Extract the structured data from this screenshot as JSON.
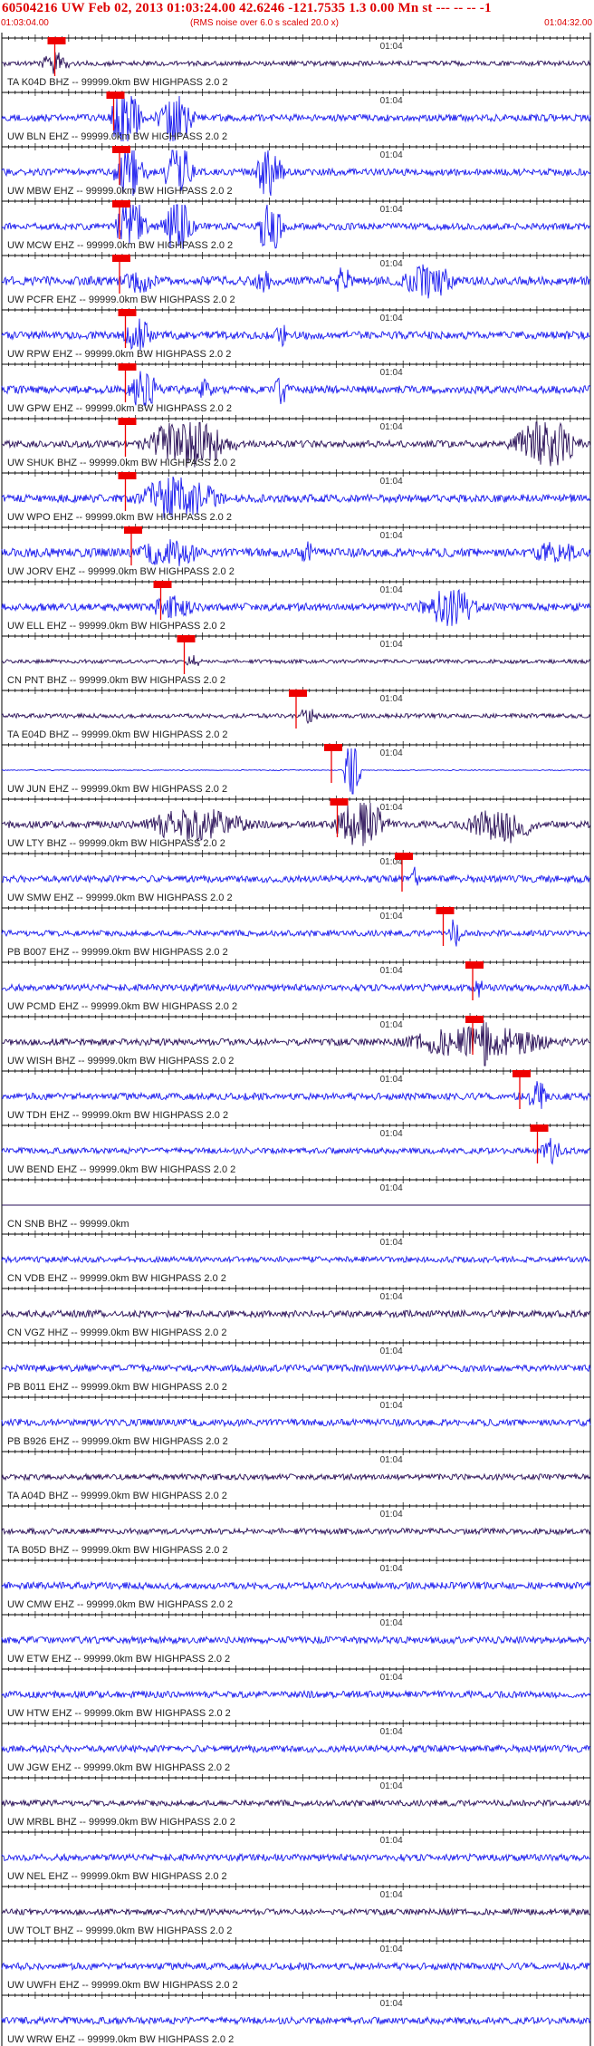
{
  "header": {
    "title": "60504216 UW Feb 02, 2013 01:03:24.00   42.6246 -121.7535  1.3 0.00 Mn st --- -- -- -1",
    "subtitle": "(RMS noise over 6.0 s scaled 20.0 x)",
    "start_time": "01:03:04.00",
    "end_time": "01:04:32.00"
  },
  "colors": {
    "header_text": "#dd0000",
    "trace_blue": "#1a1aee",
    "trace_dark": "#2a1058",
    "pick": "#ee0000",
    "axis": "#000000",
    "label": "#222222"
  },
  "chart_data": {
    "type": "line",
    "x_unit": "time",
    "x_start": "01:03:04.00",
    "x_end": "01:04:32.00",
    "minute_tick_label": "01:04",
    "series": [
      {
        "name": "TA K04D BHZ -- 99999.0km BW  HIGHPASS  2.0  2",
        "color": "dark",
        "pick": 0.09,
        "amp": 0.25,
        "bursts": [
          [
            0.06,
            0.12,
            1.2
          ]
        ]
      },
      {
        "name": "UW BLN EHZ -- 99999.0km BW  HIGHPASS  2.0  2",
        "color": "blue",
        "pick": 0.19,
        "amp": 0.35,
        "bursts": [
          [
            0.18,
            0.24,
            3.5
          ],
          [
            0.26,
            0.33,
            2.8
          ]
        ]
      },
      {
        "name": "UW MBW EHZ -- 99999.0km BW  HIGHPASS  2.0  2",
        "color": "blue",
        "pick": 0.2,
        "amp": 0.35,
        "bursts": [
          [
            0.19,
            0.25,
            3.5
          ],
          [
            0.27,
            0.33,
            3.0
          ],
          [
            0.43,
            0.48,
            3.0
          ]
        ]
      },
      {
        "name": "UW MCW EHZ -- 99999.0km BW  HIGHPASS  2.0  2",
        "color": "blue",
        "pick": 0.2,
        "amp": 0.35,
        "bursts": [
          [
            0.19,
            0.25,
            3.0
          ],
          [
            0.27,
            0.33,
            2.8
          ],
          [
            0.43,
            0.48,
            2.8
          ]
        ]
      },
      {
        "name": "UW PCFR EHZ -- 99999.0km BW  HIGHPASS  2.0  2",
        "color": "blue",
        "pick": 0.2,
        "amp": 0.45,
        "bursts": [
          [
            0.2,
            0.27,
            1.3
          ],
          [
            0.42,
            0.47,
            1.2
          ],
          [
            0.56,
            0.6,
            1.5
          ],
          [
            0.67,
            0.78,
            1.8
          ]
        ]
      },
      {
        "name": "UW RPW EHZ -- 99999.0km BW  HIGHPASS  2.0  2",
        "color": "blue",
        "pick": 0.21,
        "amp": 0.4,
        "bursts": [
          [
            0.2,
            0.26,
            1.8
          ],
          [
            0.46,
            0.49,
            1.2
          ]
        ]
      },
      {
        "name": "UW GPW EHZ -- 99999.0km BW  HIGHPASS  2.0  2",
        "color": "blue",
        "pick": 0.21,
        "amp": 0.4,
        "bursts": [
          [
            0.21,
            0.27,
            2.0
          ],
          [
            0.33,
            0.36,
            1.2
          ],
          [
            0.46,
            0.49,
            1.5
          ]
        ]
      },
      {
        "name": "UW SHUK BHZ -- 99999.0km BW  HIGHPASS  2.0  2",
        "color": "dark",
        "pick": 0.21,
        "amp": 0.35,
        "bursts": [
          [
            0.23,
            0.4,
            2.5
          ],
          [
            0.86,
            0.99,
            2.5
          ]
        ]
      },
      {
        "name": "UW WPO EHZ -- 99999.0km BW  HIGHPASS  2.0  2",
        "color": "blue",
        "pick": 0.21,
        "amp": 0.4,
        "bursts": [
          [
            0.22,
            0.38,
            2.3
          ]
        ]
      },
      {
        "name": "UW JORV EHZ -- 99999.0km BW  HIGHPASS  2.0  2",
        "color": "blue",
        "pick": 0.22,
        "amp": 0.45,
        "bursts": [
          [
            0.22,
            0.35,
            1.5
          ],
          [
            0.5,
            0.54,
            1.2
          ],
          [
            0.89,
            0.99,
            1.2
          ]
        ]
      },
      {
        "name": "UW ELL EHZ -- 99999.0km BW  HIGHPASS  2.0  2",
        "color": "blue",
        "pick": 0.27,
        "amp": 0.4,
        "bursts": [
          [
            0.24,
            0.34,
            1.2
          ],
          [
            0.7,
            0.82,
            2.0
          ]
        ]
      },
      {
        "name": "CN PNT BHZ -- 99999.0km BW  HIGHPASS  2.0  2",
        "color": "dark",
        "pick": 0.31,
        "amp": 0.2,
        "bursts": [
          [
            0.31,
            0.34,
            0.8
          ]
        ]
      },
      {
        "name": "TA E04D BHZ -- 99999.0km BW  HIGHPASS  2.0  2",
        "color": "dark",
        "pick": 0.5,
        "amp": 0.22,
        "bursts": [
          [
            0.5,
            0.54,
            1.0
          ]
        ]
      },
      {
        "name": "UW JUN EHZ -- 99999.0km BW  HIGHPASS  2.0  2",
        "color": "blue",
        "pick": 0.56,
        "amp": 0.05,
        "bursts": [
          [
            0.58,
            0.61,
            3.8
          ]
        ]
      },
      {
        "name": "UW LTY BHZ -- 99999.0km BW  HIGHPASS  2.0  2",
        "color": "dark",
        "pick": 0.57,
        "amp": 0.35,
        "bursts": [
          [
            0.22,
            0.44,
            1.8
          ],
          [
            0.56,
            0.66,
            2.8
          ],
          [
            0.78,
            0.92,
            2.0
          ]
        ]
      },
      {
        "name": "UW SMW EHZ -- 99999.0km BW  HIGHPASS  2.0  2",
        "color": "blue",
        "pick": 0.68,
        "amp": 0.35,
        "bursts": [
          [
            0.69,
            0.71,
            1.5
          ]
        ]
      },
      {
        "name": "PB B007 EHZ -- 99999.0km BW  HIGHPASS  2.0  2",
        "color": "blue",
        "pick": 0.75,
        "amp": 0.3,
        "bursts": [
          [
            0.76,
            0.78,
            1.8
          ]
        ]
      },
      {
        "name": "UW PCMD EHZ -- 99999.0km BW  HIGHPASS  2.0  2",
        "color": "blue",
        "pick": 0.8,
        "amp": 0.35,
        "bursts": [
          [
            0.8,
            0.82,
            1.0
          ]
        ]
      },
      {
        "name": "UW WISH BHZ -- 99999.0km BW  HIGHPASS  2.0  2",
        "color": "dark",
        "pick": 0.8,
        "amp": 0.35,
        "bursts": [
          [
            0.66,
            0.96,
            1.6
          ],
          [
            0.81,
            0.83,
            2.8
          ]
        ]
      },
      {
        "name": "UW TDH EHZ -- 99999.0km BW  HIGHPASS  2.0  2",
        "color": "blue",
        "pick": 0.88,
        "amp": 0.35,
        "bursts": [
          [
            0.89,
            0.93,
            1.6
          ]
        ]
      },
      {
        "name": "UW BEND EHZ -- 99999.0km BW  HIGHPASS  2.0  2",
        "color": "blue",
        "pick": 0.91,
        "amp": 0.3,
        "bursts": [
          [
            0.91,
            0.96,
            1.4
          ]
        ]
      },
      {
        "name": "CN SNB BHZ -- 99999.0km",
        "color": "dark",
        "pick": null,
        "amp": 0.0,
        "bursts": []
      },
      {
        "name": "CN VDB EHZ -- 99999.0km BW  HIGHPASS  2.0  2",
        "color": "blue",
        "pick": null,
        "amp": 0.3,
        "bursts": []
      },
      {
        "name": "CN VGZ HHZ -- 99999.0km BW  HIGHPASS  2.0  2",
        "color": "dark",
        "pick": null,
        "amp": 0.35,
        "bursts": []
      },
      {
        "name": "PB B011 EHZ -- 99999.0km BW  HIGHPASS  2.0  2",
        "color": "blue",
        "pick": null,
        "amp": 0.35,
        "bursts": []
      },
      {
        "name": "PB B926 EHZ -- 99999.0km BW  HIGHPASS  2.0  2",
        "color": "blue",
        "pick": null,
        "amp": 0.35,
        "bursts": []
      },
      {
        "name": "TA A04D BHZ -- 99999.0km BW  HIGHPASS  2.0  2",
        "color": "dark",
        "pick": null,
        "amp": 0.3,
        "bursts": []
      },
      {
        "name": "TA B05D BHZ -- 99999.0km BW  HIGHPASS  2.0  2",
        "color": "dark",
        "pick": null,
        "amp": 0.3,
        "bursts": []
      },
      {
        "name": "UW CMW EHZ -- 99999.0km BW  HIGHPASS  2.0  2",
        "color": "blue",
        "pick": null,
        "amp": 0.35,
        "bursts": []
      },
      {
        "name": "UW ETW EHZ -- 99999.0km BW  HIGHPASS  2.0  2",
        "color": "blue",
        "pick": null,
        "amp": 0.35,
        "bursts": []
      },
      {
        "name": "UW HTW EHZ -- 99999.0km BW  HIGHPASS  2.0  2",
        "color": "blue",
        "pick": null,
        "amp": 0.35,
        "bursts": []
      },
      {
        "name": "UW JGW EHZ -- 99999.0km BW  HIGHPASS  2.0  2",
        "color": "blue",
        "pick": null,
        "amp": 0.35,
        "bursts": []
      },
      {
        "name": "UW MRBL BHZ -- 99999.0km BW  HIGHPASS  2.0  2",
        "color": "dark",
        "pick": null,
        "amp": 0.3,
        "bursts": []
      },
      {
        "name": "UW NEL EHZ -- 99999.0km BW  HIGHPASS  2.0  2",
        "color": "blue",
        "pick": null,
        "amp": 0.35,
        "bursts": []
      },
      {
        "name": "UW TOLT BHZ -- 99999.0km BW  HIGHPASS  2.0  2",
        "color": "dark",
        "pick": null,
        "amp": 0.3,
        "bursts": []
      },
      {
        "name": "UW UWFH EHZ -- 99999.0km BW  HIGHPASS  2.0  2",
        "color": "blue",
        "pick": null,
        "amp": 0.35,
        "bursts": []
      },
      {
        "name": "UW WRW EHZ -- 99999.0km BW  HIGHPASS  2.0  2",
        "color": "blue",
        "pick": null,
        "amp": 0.35,
        "bursts": []
      }
    ]
  }
}
